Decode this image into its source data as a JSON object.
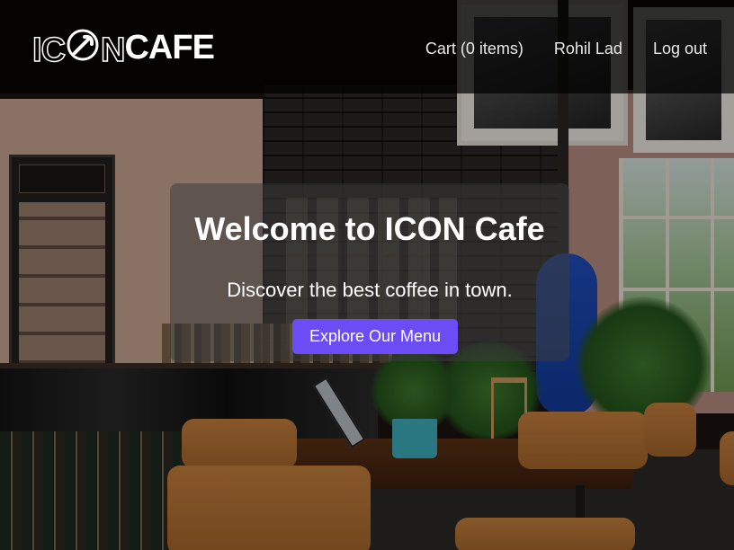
{
  "brand": {
    "logo_icon_text": "ICON",
    "logo_cafe_text": "CAFE",
    "logo_mark": "coffee-cup-icon"
  },
  "nav": {
    "links": [
      {
        "label": "Cart (0 items)"
      },
      {
        "label": "Rohil Lad"
      },
      {
        "label": "Log out"
      }
    ]
  },
  "hero": {
    "title": "Welcome to ICON Cafe",
    "subtitle": "Discover the best coffee in town.",
    "cta_label": "Explore Our Menu"
  },
  "colors": {
    "accent": "#6c4df5",
    "navbar_bg": "rgba(0,0,0,0.72)",
    "hero_card_bg": "rgba(60,60,60,0.55)"
  }
}
